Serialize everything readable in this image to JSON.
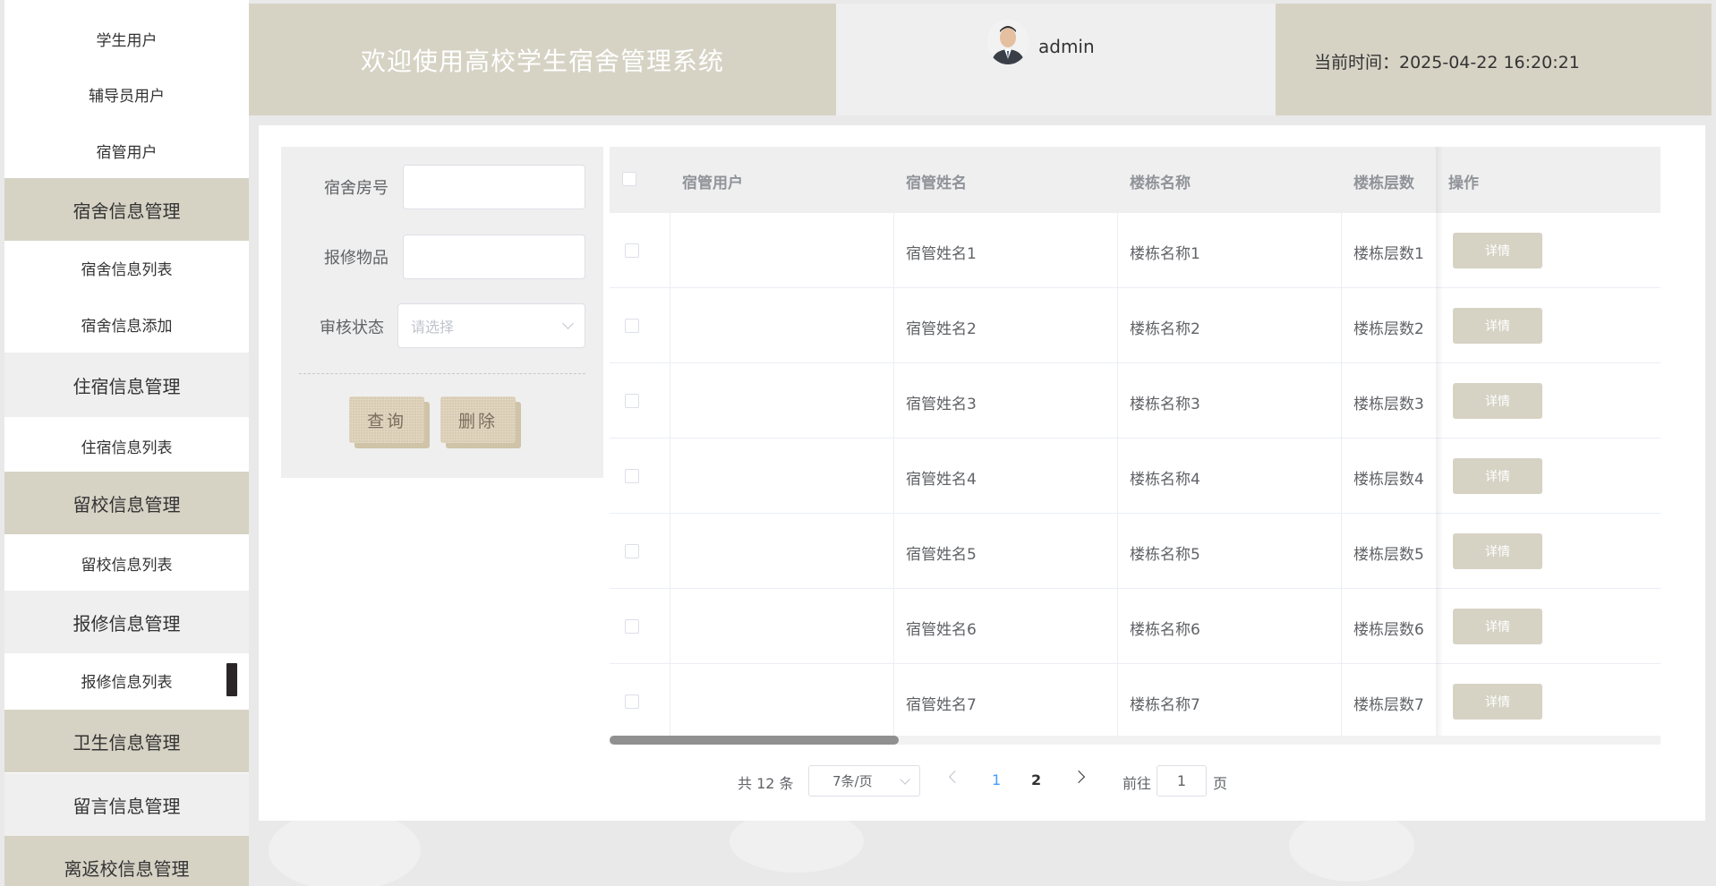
{
  "sidebar": {
    "items": [
      {
        "label": "学生用户"
      },
      {
        "label": "辅导员用户"
      },
      {
        "label": "宿管用户"
      },
      {
        "label": "宿舍信息管理"
      },
      {
        "label": "宿舍信息列表"
      },
      {
        "label": "宿舍信息添加"
      },
      {
        "label": "住宿信息管理"
      },
      {
        "label": "住宿信息列表"
      },
      {
        "label": "留校信息管理"
      },
      {
        "label": "留校信息列表"
      },
      {
        "label": "报修信息管理"
      },
      {
        "label": "报修信息列表"
      },
      {
        "label": "卫生信息管理"
      },
      {
        "label": "留言信息管理"
      },
      {
        "label": "离返校信息管理"
      }
    ]
  },
  "header": {
    "title": "欢迎使用高校学生宿舍管理系统",
    "user": "admin",
    "time_label": "当前时间：2025-04-22 16:20:21"
  },
  "search": {
    "room_label": "宿舍房号",
    "room_value": "",
    "item_label": "报修物品",
    "item_value": "",
    "status_label": "审核状态",
    "status_placeholder": "请选择",
    "query_button": "查询",
    "delete_button": "删除"
  },
  "table": {
    "columns": [
      "宿管用户",
      "宿管姓名",
      "楼栋名称",
      "楼栋层数",
      "操作"
    ],
    "rows": [
      {
        "user": "",
        "name": "宿管姓名1",
        "building": "楼栋名称1",
        "floors": "楼栋层数1",
        "action": "详情"
      },
      {
        "user": "",
        "name": "宿管姓名2",
        "building": "楼栋名称2",
        "floors": "楼栋层数2",
        "action": "详情"
      },
      {
        "user": "",
        "name": "宿管姓名3",
        "building": "楼栋名称3",
        "floors": "楼栋层数3",
        "action": "详情"
      },
      {
        "user": "",
        "name": "宿管姓名4",
        "building": "楼栋名称4",
        "floors": "楼栋层数4",
        "action": "详情"
      },
      {
        "user": "",
        "name": "宿管姓名5",
        "building": "楼栋名称5",
        "floors": "楼栋层数5",
        "action": "详情"
      },
      {
        "user": "",
        "name": "宿管姓名6",
        "building": "楼栋名称6",
        "floors": "楼栋层数6",
        "action": "详情"
      },
      {
        "user": "",
        "name": "宿管姓名7",
        "building": "楼栋名称7",
        "floors": "楼栋层数7",
        "action": "详情"
      }
    ]
  },
  "pagination": {
    "total": "共 12 条",
    "page_size": "7条/页",
    "pages": [
      "1",
      "2"
    ],
    "current": "1",
    "goto_label": "前往",
    "goto_value": "1",
    "page_suffix": "页"
  },
  "colors": {
    "accent": "#d6d3c5",
    "active_page": "#409eff",
    "scrollbar": "#2a2628"
  }
}
